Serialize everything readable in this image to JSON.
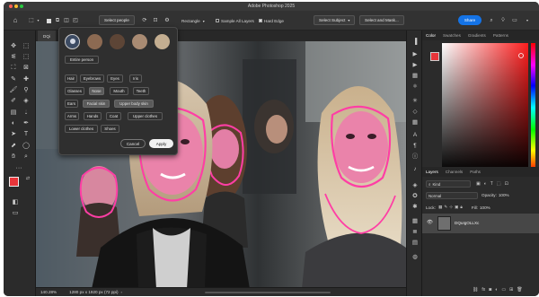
{
  "app": {
    "title": "Adobe Photoshop 2025",
    "traffic_colors": [
      "#ff5f57",
      "#febc2e",
      "#28c840"
    ]
  },
  "options_bar": {
    "select_people": "Select people",
    "shape_mode": "Rectangle",
    "sample_all_layers": "Sample All Layers",
    "hard_edge": "Hard Edge",
    "select_subject": "Select Subject",
    "select_and_mask": "Select and Mask...",
    "share": "Share"
  },
  "document": {
    "tab": "DQi"
  },
  "status": {
    "zoom": "140.28%",
    "doc_size": "1280 px x 1920 px (72 ppi)"
  },
  "people_panel": {
    "entire_person": "Entire person",
    "parts": [
      [
        "Hair",
        "Eyebrows",
        "Eyes",
        "Iris"
      ],
      [
        "Glasses",
        "Nose",
        "Mouth",
        "Teeth"
      ],
      [
        "Ears",
        "Facial skin",
        "Upper body skin"
      ],
      [
        "Arms",
        "Hands",
        "Coat",
        "Upper clothes"
      ],
      [
        "Lower clothes",
        "Shoes"
      ]
    ],
    "active_parts": [
      "Nose",
      "Facial skin",
      "Upper body skin"
    ],
    "cancel": "Cancel",
    "apply": "Apply"
  },
  "color_panel": {
    "tabs": [
      "Color",
      "Swatches",
      "Gradients",
      "Patterns"
    ],
    "active_tab": "Color",
    "foreground": "#e8353a"
  },
  "layers_panel": {
    "tabs": [
      "Layers",
      "Channels",
      "Paths"
    ],
    "active_tab": "Layers",
    "filter": "Kind",
    "blend_mode": "Normal",
    "opacity_label": "Opacity:",
    "opacity": "100%",
    "lock_label": "Lock:",
    "fill_label": "Fill:",
    "fill": "100%",
    "layers": [
      {
        "name": "DQuIgOLLXc"
      }
    ],
    "footer_icons": [
      "link-icon",
      "fx-icon",
      "mask-icon",
      "adjustment-icon",
      "folder-icon",
      "new-layer-icon",
      "trash-icon"
    ]
  }
}
